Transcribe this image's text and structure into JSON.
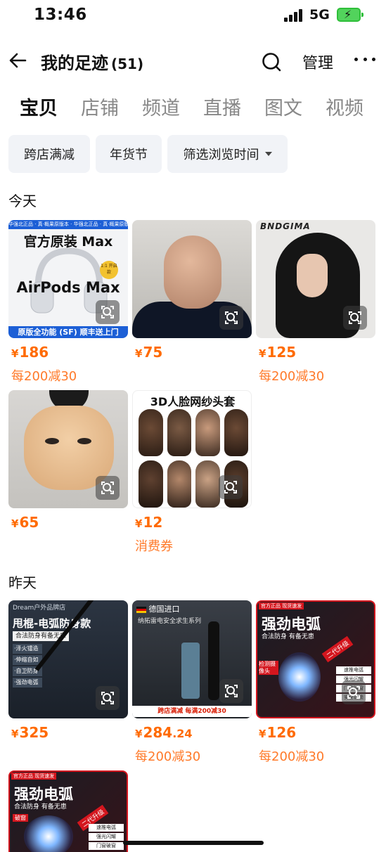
{
  "status_bar": {
    "time": "13:46",
    "network": "5G",
    "battery_icon": "battery-charging-icon"
  },
  "nav": {
    "title": "我的足迹",
    "count": "(51)",
    "manage": "管理"
  },
  "tabs": [
    {
      "label": "宝贝",
      "active": true
    },
    {
      "label": "店铺"
    },
    {
      "label": "频道"
    },
    {
      "label": "直播"
    },
    {
      "label": "图文"
    },
    {
      "label": "视频"
    }
  ],
  "filters": [
    {
      "label": "跨店满减"
    },
    {
      "label": "年货节"
    },
    {
      "label": "筛选浏览时间"
    }
  ],
  "sections": [
    {
      "label": "今天",
      "items": [
        {
          "price": "186",
          "promo": "每200减30",
          "art": {
            "top_strip": "华强北正品 · 真·概果原版本 · 华强北正品 · 真·概果原版本",
            "headline": "官方原装 Max",
            "product": "AirPods Max",
            "badge": "1:1 开启款",
            "bottom_strip": "原版全功能 (SF) 顺丰送上门"
          }
        },
        {
          "price": "75",
          "promo": ""
        },
        {
          "price": "125",
          "promo": "每200减30",
          "art": {
            "brand": "BNDGIMA"
          }
        },
        {
          "price": "65",
          "promo": ""
        },
        {
          "price": "12",
          "promo": "消费券",
          "art": {
            "headline": "3D人脸网纱头套"
          }
        }
      ]
    },
    {
      "label": "昨天",
      "items": [
        {
          "price": "325",
          "promo": "",
          "art": {
            "store": "Dream户外品牌店",
            "headline": "甩棍-电弧防身款",
            "sub": "合法防身有备无患",
            "features": [
              "·泽火镭造",
              "·伸缩自如",
              "·自卫防身",
              "·强劲电弧"
            ]
          }
        },
        {
          "price": "284",
          "price_decimal": ".24",
          "promo": "每200减30",
          "art": {
            "origin": "德国进口",
            "series": "纳拓雷电安全求生系列",
            "banner": "跨店满减 每满200减30"
          }
        },
        {
          "price": "126",
          "promo": "每200减30",
          "art": {
            "corner": "官方正品 现货速发",
            "headline": "强劲电弧",
            "sub": "合法防身 有备无患",
            "upgrade": "二代升级",
            "label_left": "检测摄像头",
            "features": [
              "速推电弧",
              "强光闪耀",
              "门窗破窗",
              "安全锁锁"
            ]
          }
        },
        {
          "price": "",
          "promo": "",
          "art": {
            "corner": "官方正品 现货速发",
            "headline": "强劲电弧",
            "sub": "合法防身 有备无患",
            "upgrade": "二代升级",
            "label_left": "破窗",
            "features": [
              "速推电弧",
              "强光闪耀",
              "门窗破窗"
            ]
          }
        }
      ]
    }
  ]
}
